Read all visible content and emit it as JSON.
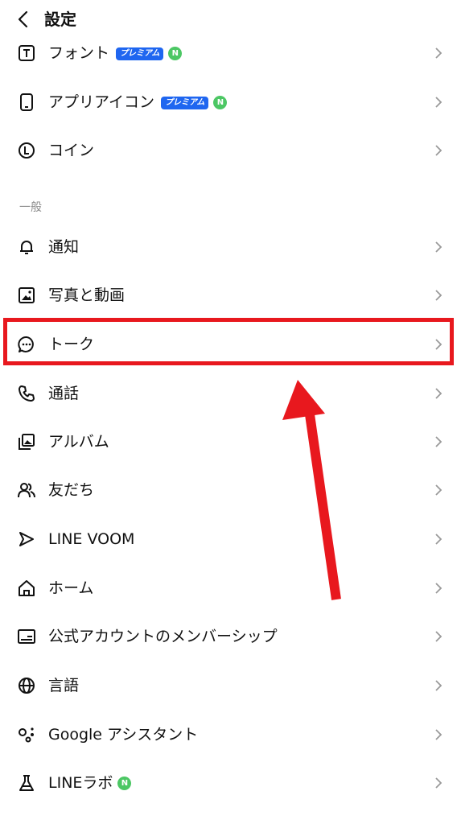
{
  "header": {
    "back_icon": "chevron-left-icon",
    "title": "設定"
  },
  "top_items": [
    {
      "label": "フォント",
      "icon": "font-icon",
      "premium_badge": "プレミアム",
      "new_badge": "N"
    },
    {
      "label": "アプリアイコン",
      "icon": "phone-icon",
      "premium_badge": "プレミアム",
      "new_badge": "N"
    },
    {
      "label": "コイン",
      "icon": "coin-icon"
    }
  ],
  "general_section": {
    "title": "一般",
    "items": [
      {
        "label": "通知",
        "icon": "bell-icon"
      },
      {
        "label": "写真と動画",
        "icon": "image-icon"
      },
      {
        "label": "トーク",
        "icon": "chat-bubble-icon"
      },
      {
        "label": "通話",
        "icon": "phone-call-icon"
      },
      {
        "label": "アルバム",
        "icon": "album-icon"
      },
      {
        "label": "友だち",
        "icon": "friends-icon"
      },
      {
        "label": "LINE VOOM",
        "icon": "voom-icon"
      },
      {
        "label": "ホーム",
        "icon": "home-icon"
      },
      {
        "label": "公式アカウントのメンバーシップ",
        "icon": "membership-card-icon"
      },
      {
        "label": "言語",
        "icon": "globe-icon"
      },
      {
        "label": "Google アシスタント",
        "icon": "assistant-icon"
      },
      {
        "label": "LINEラボ",
        "icon": "flask-icon",
        "new_badge": "N"
      }
    ]
  },
  "annotation": {
    "highlight_color": "#e8181e",
    "highlighted_item": "トーク"
  },
  "colors": {
    "premium_badge": "#1f66f0",
    "new_badge": "#4cc764",
    "section_text": "#8a8a8a",
    "chevron": "#9a9a9a"
  }
}
